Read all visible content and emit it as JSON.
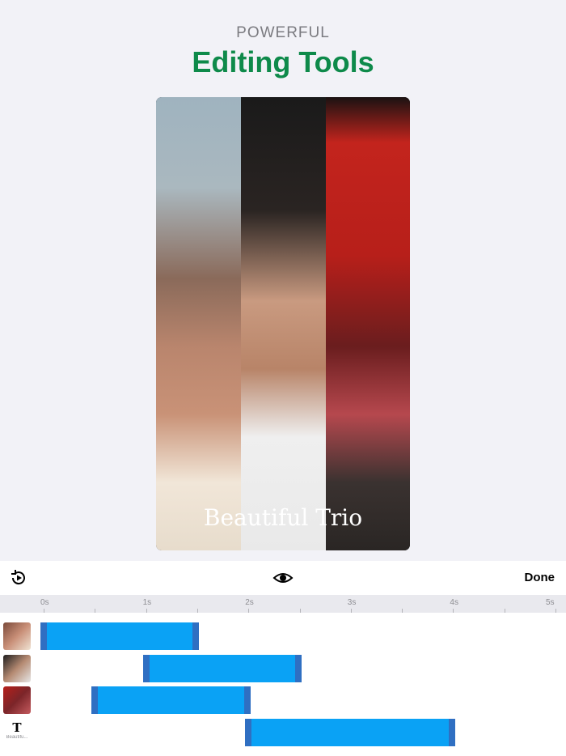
{
  "header": {
    "kicker": "POWERFUL",
    "title": "Editing Tools"
  },
  "preview": {
    "caption": "Beautiful Trio"
  },
  "toolbar": {
    "done_label": "Done",
    "left_icon": "replay-icon",
    "center_icon": "eye-icon"
  },
  "ruler": {
    "labels": [
      "0s",
      "1s",
      "2s",
      "3s",
      "4s",
      "5s"
    ]
  },
  "tracks": [
    {
      "type": "photo",
      "start_s": 0.0,
      "end_s": 1.55
    },
    {
      "type": "photo",
      "start_s": 1.0,
      "end_s": 2.55
    },
    {
      "type": "photo",
      "start_s": 0.5,
      "end_s": 2.05
    },
    {
      "type": "text",
      "label": "T",
      "sublabel": "Beautifu...",
      "start_s": 2.0,
      "end_s": 4.05
    }
  ],
  "colors": {
    "accent": "#0e8a4a",
    "clip": "#0aa2f5",
    "clip_handle": "#2f6fc2"
  }
}
